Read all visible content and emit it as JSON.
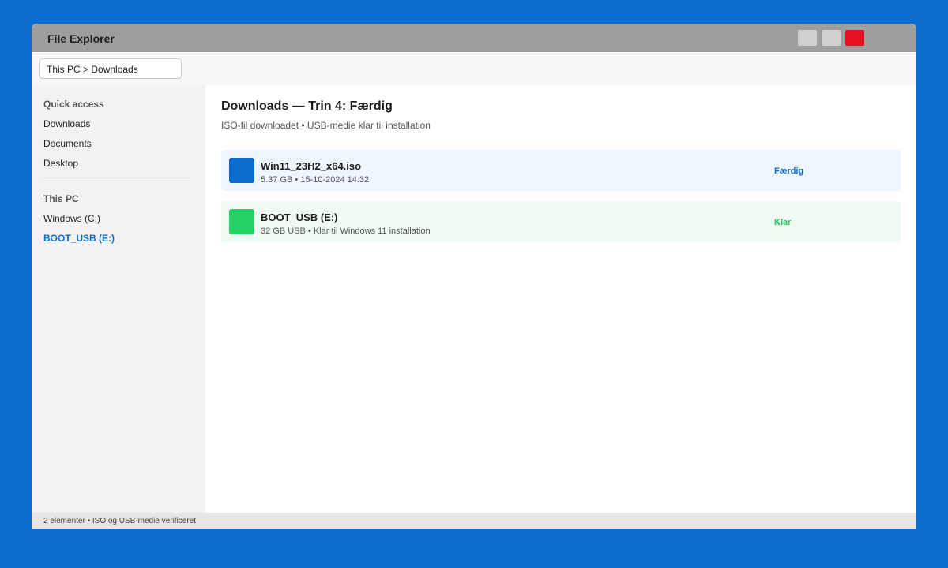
{
  "window": {
    "title": "File Explorer"
  },
  "address": {
    "path": "This PC > Downloads"
  },
  "sidebar": {
    "quick_access_heading": "Quick access",
    "quick_access_items": [
      {
        "label": "Downloads"
      },
      {
        "label": "Documents"
      },
      {
        "label": "Desktop"
      }
    ],
    "this_pc_heading": "This PC",
    "this_pc_items": [
      {
        "label": "Windows (C:)"
      },
      {
        "label": "BOOT_USB (E:)",
        "active": true
      }
    ]
  },
  "main": {
    "title": "Downloads — Trin 4: Færdig",
    "subtitle": "ISO-fil downloadet • USB-medie klar til installation",
    "files": [
      {
        "name": "Win11_23H2_x64.iso",
        "meta": "5.37 GB • 15-10-2024 14:32",
        "status": "Færdig",
        "icon": "iso-file-icon",
        "icon_color": "#0a6cce",
        "status_color": "#0a6cce"
      },
      {
        "name": "BOOT_USB (E:)",
        "meta": "32 GB USB • Klar til Windows 11 installation",
        "status": "Klar",
        "icon": "usb-drive-icon",
        "icon_color": "#22d066",
        "status_color": "#22c15d"
      }
    ]
  },
  "statusbar": {
    "text": "2 elementer • ISO og USB-medie verificeret"
  },
  "colors": {
    "desktop_bg": "#0a6cce",
    "titlebar_bg": "#9e9e9e",
    "close_button": "#e81123",
    "accent": "#0a6cce"
  }
}
